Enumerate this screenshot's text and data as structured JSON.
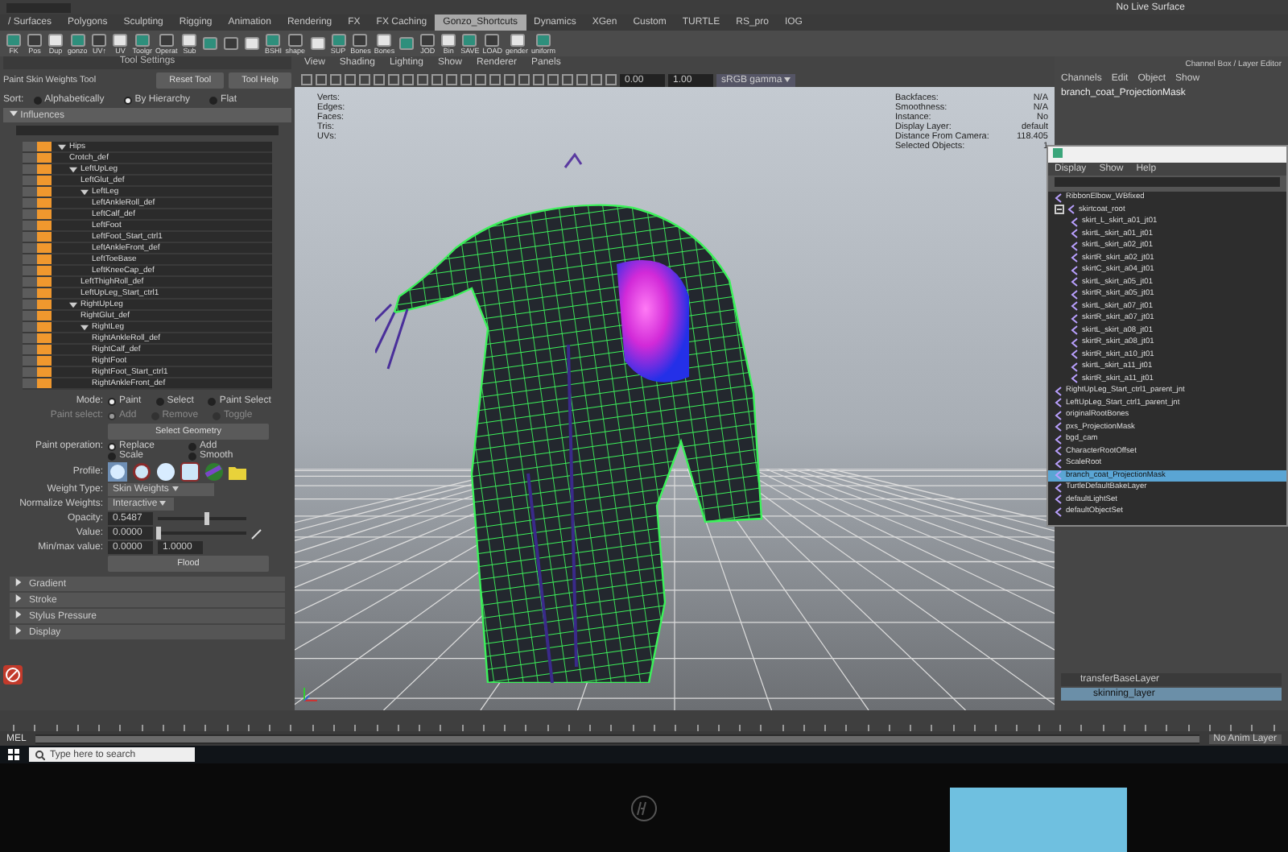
{
  "shelf": {
    "tabs": [
      {
        "label": "/ Surfaces",
        "selected": false
      },
      {
        "label": "Polygons",
        "selected": false
      },
      {
        "label": "Sculpting",
        "selected": false
      },
      {
        "label": "Rigging",
        "selected": false
      },
      {
        "label": "Animation",
        "selected": false
      },
      {
        "label": "Rendering",
        "selected": false
      },
      {
        "label": "FX",
        "selected": false
      },
      {
        "label": "FX Caching",
        "selected": false
      },
      {
        "label": "Gonzo_Shortcuts",
        "selected": true
      },
      {
        "label": "Dynamics",
        "selected": false
      },
      {
        "label": "XGen",
        "selected": false
      },
      {
        "label": "Custom",
        "selected": false
      },
      {
        "label": "TURTLE",
        "selected": false
      },
      {
        "label": "RS_pro",
        "selected": false
      },
      {
        "label": "IOG",
        "selected": false
      }
    ],
    "buttons": [
      {
        "kind": "labeled",
        "label": "FK"
      },
      {
        "kind": "labeled",
        "label": "Pos"
      },
      {
        "kind": "labeled",
        "label": "Dup"
      },
      {
        "kind": "labeled",
        "label": "gonzo"
      },
      {
        "kind": "labeled",
        "label": "UV↑"
      },
      {
        "kind": "labeled",
        "label": "UV"
      },
      {
        "kind": "labeled",
        "label": "Toolgr"
      },
      {
        "kind": "labeled",
        "label": "Operat"
      },
      {
        "kind": "labeled",
        "label": "Sub"
      },
      {
        "kind": "icon"
      },
      {
        "kind": "icon"
      },
      {
        "kind": "icon"
      },
      {
        "kind": "labeled",
        "label": "BSHI"
      },
      {
        "kind": "labeled",
        "label": "shape"
      },
      {
        "kind": "icon"
      },
      {
        "kind": "labeled",
        "label": "SUP"
      },
      {
        "kind": "labeled",
        "label": "Bones"
      },
      {
        "kind": "labeled",
        "label": "Bones"
      },
      {
        "kind": "icon"
      },
      {
        "kind": "labeled",
        "label": "JOD"
      },
      {
        "kind": "labeled",
        "label": "Bin"
      },
      {
        "kind": "labeled",
        "label": "SAVE"
      },
      {
        "kind": "labeled",
        "label": "LOAD"
      },
      {
        "kind": "labeled",
        "label": "gender"
      },
      {
        "kind": "labeled",
        "label": "uniform"
      }
    ],
    "live_surface": "No Live Surface"
  },
  "tool_settings": {
    "title": "Tool Settings",
    "tool": "Paint Skin Weights Tool",
    "buttons": [
      "Reset Tool",
      "Tool Help"
    ],
    "sort": {
      "label": "Sort:",
      "options": [
        {
          "label": "Alphabetically",
          "selected": false
        },
        {
          "label": "By Hierarchy",
          "selected": true
        },
        {
          "label": "Flat",
          "selected": false
        }
      ]
    },
    "influences": {
      "title": "Influences",
      "items": [
        {
          "label": "Hips",
          "expanded": true,
          "children": [
            {
              "label": "Crotch_def"
            },
            {
              "label": "LeftUpLeg",
              "expanded": true,
              "children": [
                {
                  "label": "LeftGlut_def"
                },
                {
                  "label": "LeftLeg",
                  "expanded": true,
                  "children": [
                    {
                      "label": "LeftAnkleRoll_def"
                    },
                    {
                      "label": "LeftCalf_def"
                    },
                    {
                      "label": "LeftFoot"
                    },
                    {
                      "label": "LeftFoot_Start_ctrl1"
                    },
                    {
                      "label": "LeftAnkleFront_def"
                    },
                    {
                      "label": "LeftToeBase"
                    },
                    {
                      "label": "LeftKneeCap_def"
                    }
                  ]
                },
                {
                  "label": "LeftThighRoll_def"
                },
                {
                  "label": "LeftUpLeg_Start_ctrl1"
                }
              ]
            },
            {
              "label": "RightUpLeg",
              "expanded": true,
              "children": [
                {
                  "label": "RightGlut_def"
                },
                {
                  "label": "RightLeg",
                  "expanded": true,
                  "children": [
                    {
                      "label": "RightAnkleRoll_def"
                    },
                    {
                      "label": "RightCalf_def"
                    },
                    {
                      "label": "RightFoot"
                    },
                    {
                      "label": "RightFoot_Start_ctrl1"
                    },
                    {
                      "label": "RightAnkleFront_def"
                    }
                  ]
                }
              ]
            }
          ]
        }
      ]
    },
    "mode": {
      "label": "Mode:",
      "options": [
        {
          "label": "Paint",
          "selected": true
        },
        {
          "label": "Select",
          "selected": false
        },
        {
          "label": "Paint Select",
          "selected": false
        }
      ]
    },
    "paint_select": {
      "label": "Paint select:",
      "options": [
        {
          "label": "Add",
          "selected": true
        },
        {
          "label": "Remove",
          "selected": false
        },
        {
          "label": "Toggle",
          "selected": false
        }
      ]
    },
    "select_geometry": "Select Geometry",
    "paint_operation": {
      "label": "Paint operation:",
      "options": [
        {
          "label": "Replace",
          "selected": true
        },
        {
          "label": "Add",
          "selected": false
        },
        {
          "label": "Scale",
          "selected": false
        },
        {
          "label": "Smooth",
          "selected": false
        }
      ]
    },
    "profile": {
      "label": "Profile:"
    },
    "weight_type": {
      "label": "Weight Type:",
      "value": "Skin Weights"
    },
    "normalize": {
      "label": "Normalize Weights:",
      "value": "Interactive"
    },
    "opacity": {
      "label": "Opacity:",
      "value": "0.5487",
      "level": 0.55
    },
    "value": {
      "label": "Value:",
      "value": "0.0000",
      "level": 0.0
    },
    "minmax": {
      "label": "Min/max value:",
      "min": "0.0000",
      "max": "1.0000"
    },
    "flood": "Flood",
    "sections": [
      {
        "label": "Gradient",
        "expanded": false
      },
      {
        "label": "Stroke",
        "expanded": false
      },
      {
        "label": "Stylus Pressure",
        "expanded": false
      },
      {
        "label": "Display",
        "expanded": false
      }
    ]
  },
  "viewport": {
    "menu": [
      "View",
      "Shading",
      "Lighting",
      "Show",
      "Renderer",
      "Panels"
    ],
    "exposure": "0.00",
    "gamma": "1.00",
    "color_space": "sRGB gamma",
    "hud_left": [
      "Verts:",
      "Edges:",
      "Faces:",
      "Tris:",
      "UVs:"
    ],
    "hud_right": [
      {
        "label": "Backfaces:",
        "value": "N/A"
      },
      {
        "label": "Smoothness:",
        "value": "N/A"
      },
      {
        "label": "Instance:",
        "value": "No"
      },
      {
        "label": "Display Layer:",
        "value": "default"
      },
      {
        "label": "Distance From Camera:",
        "value": "118.405"
      },
      {
        "label": "Selected Objects:",
        "value": "1"
      }
    ]
  },
  "channel_box": {
    "title": "Channel Box / Layer Editor",
    "menu": [
      "Channels",
      "Edit",
      "Object",
      "Show"
    ],
    "object": "branch_coat_ProjectionMask"
  },
  "outliner": {
    "menu": [
      "Display",
      "Show",
      "Help"
    ],
    "items": [
      {
        "label": "RibbonElbow_WBfixed"
      },
      {
        "label": "skirtcoat_root",
        "expanded": true,
        "children": [
          {
            "label": "skirt_L_skirt_a01_jt01"
          },
          {
            "label": "skirtL_skirt_a01_jt01"
          },
          {
            "label": "skirtL_skirt_a02_jt01"
          },
          {
            "label": "skirtR_skirt_a02_jt01"
          },
          {
            "label": "skirtC_skirt_a04_jt01"
          },
          {
            "label": "skirtL_skirt_a05_jt01"
          },
          {
            "label": "skirtR_skirt_a05_jt01"
          },
          {
            "label": "skirtL_skirt_a07_jt01"
          },
          {
            "label": "skirtR_skirt_a07_jt01"
          },
          {
            "label": "skirtL_skirt_a08_jt01"
          },
          {
            "label": "skirtR_skirt_a08_jt01"
          },
          {
            "label": "skirtR_skirt_a10_jt01"
          },
          {
            "label": "skirtL_skirt_a11_jt01"
          },
          {
            "label": "skirtR_skirt_a11_jt01"
          }
        ]
      },
      {
        "label": "RightUpLeg_Start_ctrl1_parent_jnt"
      },
      {
        "label": "LeftUpLeg_Start_ctrl1_parent_jnt"
      },
      {
        "label": "originalRootBones"
      },
      {
        "label": "pxs_ProjectionMask"
      },
      {
        "label": "bgd_cam"
      },
      {
        "label": "CharacterRootOffset"
      },
      {
        "label": "ScaleRoot"
      },
      {
        "label": "branch_coat_ProjectionMask",
        "selected": true
      },
      {
        "label": "TurtleDefaultBakeLayer"
      },
      {
        "label": "defaultLightSet"
      },
      {
        "label": "defaultObjectSet"
      }
    ]
  },
  "layers": {
    "group": "transferBaseLayer",
    "layer": "skinning_layer"
  },
  "timeline": {
    "anim_layer": "No Anim Layer",
    "command": "MEL",
    "range": {
      "level": 1
    }
  },
  "taskbar": {
    "search": "Type here to search"
  }
}
